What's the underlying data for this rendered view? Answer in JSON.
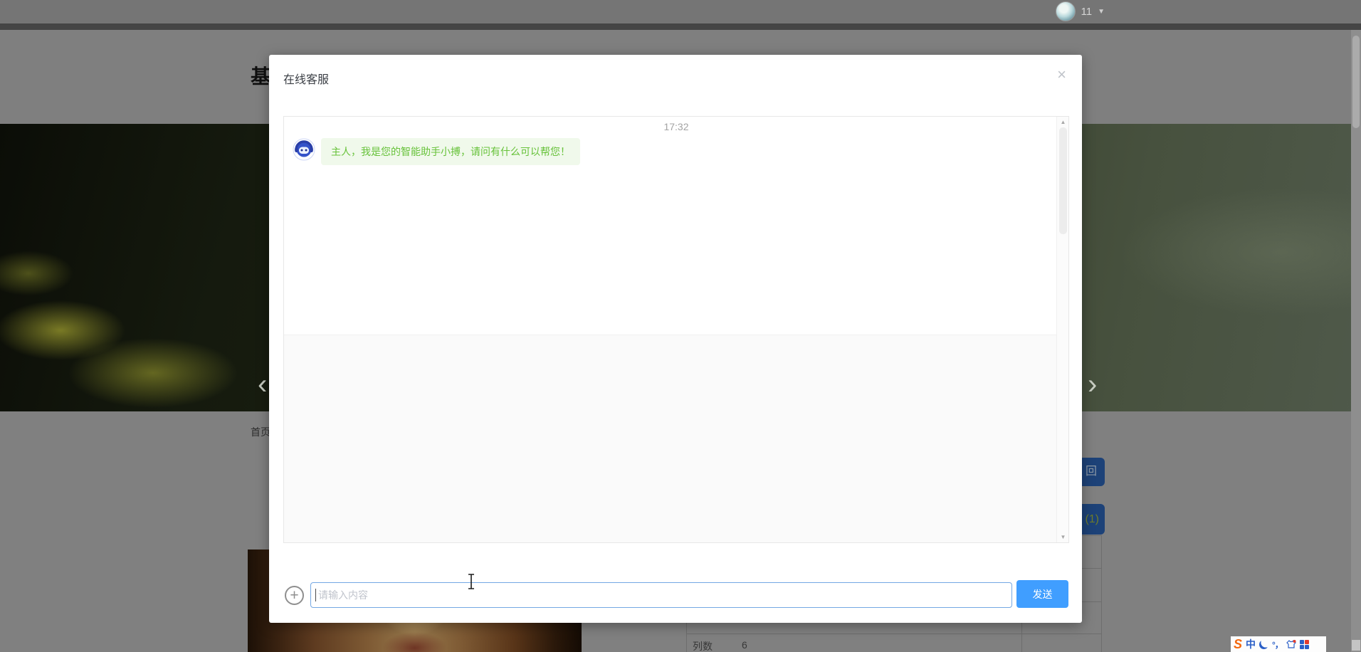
{
  "topbar": {
    "user_count": "11"
  },
  "page": {
    "title": "基于SpringBoot的图书馆在线占座系统",
    "breadcrumb_home": "首页",
    "spec_row": {
      "label": "列数",
      "value": "6"
    },
    "back_button_visible_label": "回",
    "count_button_visible_label": "(1)"
  },
  "modal": {
    "title": "在线客服",
    "close_glyph": "×",
    "chat": {
      "timestamp": "17:32",
      "bot_message": "主人，我是您的智能助手小搏，请问有什么可以帮您！"
    },
    "input_placeholder": "请输入内容",
    "send_label": "发送"
  },
  "icons": {
    "chevron_left": "‹",
    "chevron_right": "›",
    "dropdown": "▼",
    "plus": "+",
    "scroll_up": "▲",
    "scroll_down": "▼"
  },
  "taskbar": {
    "ime_logo": "S",
    "ime_lang": "中",
    "ime_punct": "°，"
  },
  "colors": {
    "accent_blue": "#409eff",
    "bubble_bg": "#f0f9eb",
    "bubble_text": "#67c23a",
    "dimmed_button_blue": "#1d4278"
  }
}
